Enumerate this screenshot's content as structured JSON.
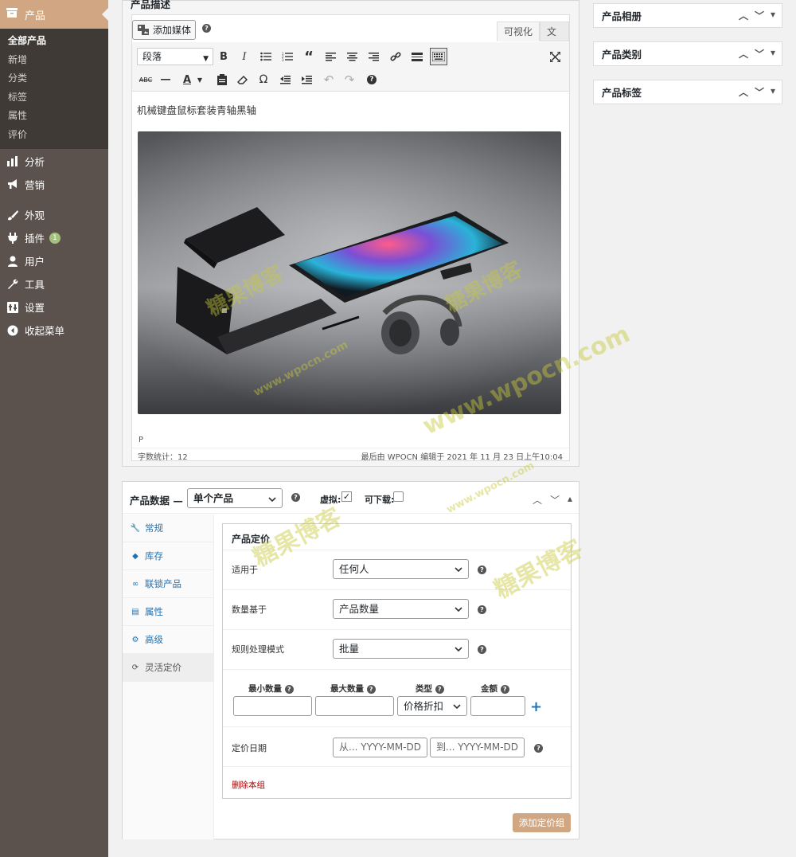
{
  "sidebar": {
    "current_menu": "产品",
    "submenu": [
      "全部产品",
      "新增",
      "分类",
      "标签",
      "属性",
      "评价"
    ],
    "items": [
      {
        "label": "分析"
      },
      {
        "label": "营销"
      },
      {
        "label": "外观"
      },
      {
        "label": "插件",
        "badge": "1"
      },
      {
        "label": "用户"
      },
      {
        "label": "工具"
      },
      {
        "label": "设置"
      },
      {
        "label": "收起菜单"
      }
    ]
  },
  "editor": {
    "title": "产品描述",
    "add_media": "添加媒体",
    "tab_visual": "可视化",
    "tab_text": "文本",
    "format": "段落",
    "content_text": "机械键盘鼠标套装青轴黑轴",
    "status_path": "P",
    "word_count": "字数统计：12",
    "last_edit": "最后由 WPOCN 编辑于 2021 年 11 月 23 日上午10:04"
  },
  "side_boxes": [
    "产品相册",
    "产品类别",
    "产品标签"
  ],
  "product_data": {
    "title": "产品数据 —",
    "type": "单个产品",
    "virtual_label": "虚拟:",
    "virtual_checked": true,
    "download_label": "可下载:",
    "tabs": [
      "常规",
      "库存",
      "联锁产品",
      "属性",
      "高级",
      "灵活定价"
    ],
    "pricing": {
      "title": "产品定价",
      "applies_label": "适用于",
      "applies_value": "任何人",
      "qty_based_label": "数量基于",
      "qty_based_value": "产品数量",
      "mode_label": "规则处理模式",
      "mode_value": "批量",
      "col_min": "最小数量",
      "col_max": "最大数量",
      "col_type": "类型",
      "col_amount": "金额",
      "type_value": "价格折扣",
      "date_label": "定价日期",
      "date_from": "从... YYYY-MM-DD",
      "date_to": "到... YYYY-MM-DD",
      "delete": "删除本组"
    },
    "add_group": "添加定价组"
  },
  "watermark": {
    "cn": "糖果博客",
    "url": "www.wpocn.com"
  }
}
